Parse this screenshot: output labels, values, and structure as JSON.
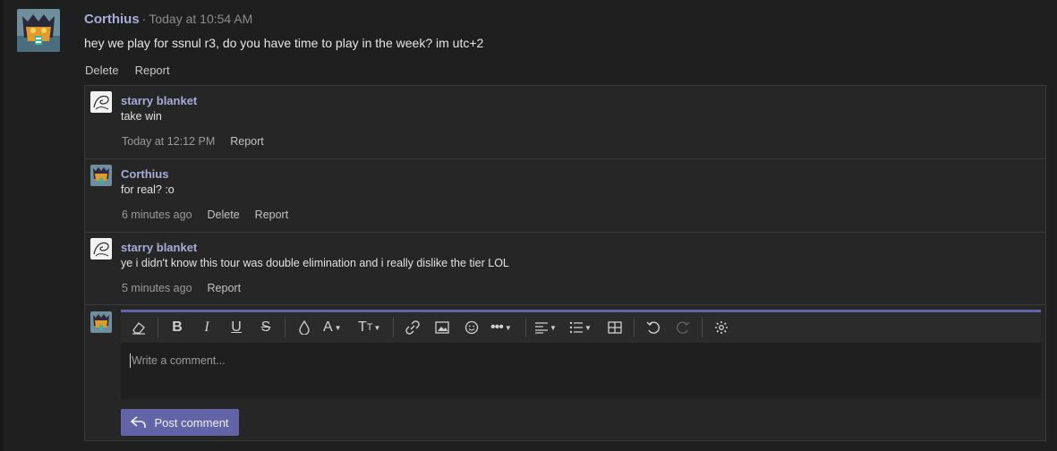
{
  "colors": {
    "accent": "#6264a7",
    "author": "#a8acd8",
    "background": "#1f1f1f",
    "thread_bg": "#262626"
  },
  "post": {
    "author": "Corthius",
    "separator": "·",
    "timestamp": "Today at 10:54 AM",
    "body": "hey we play for ssnul r3, do you have time to play in the week? im utc+2",
    "actions": {
      "delete": "Delete",
      "report": "Report"
    }
  },
  "replies": [
    {
      "author": "starry blanket",
      "text": "take win",
      "time": "Today at 12:12 PM",
      "report": "Report"
    },
    {
      "author": "Corthius",
      "text": "for real? :o",
      "time": "6 minutes ago",
      "delete": "Delete",
      "report": "Report"
    },
    {
      "author": "starry blanket",
      "text": "ye i didn't know this tour was double elimination and i really dislike the tier LOL",
      "time": "5 minutes ago",
      "report": "Report"
    }
  ],
  "composer": {
    "placeholder": "Write a comment...",
    "post_label": "Post comment",
    "toolbar_icons": [
      "eraser-icon",
      "bold-icon",
      "italic-icon",
      "underline-icon",
      "strikethrough-icon",
      "highlight-icon",
      "font-color-icon",
      "font-size-icon",
      "link-icon",
      "image-icon",
      "emoji-icon",
      "more-options-icon",
      "align-icon",
      "list-icon",
      "table-icon",
      "undo-icon",
      "redo-icon",
      "settings-icon"
    ],
    "toolbar_glyphs": {
      "bold": "B",
      "italic": "I",
      "underline": "U",
      "strike": "S",
      "font_color": "A",
      "font_size": "T"
    }
  }
}
